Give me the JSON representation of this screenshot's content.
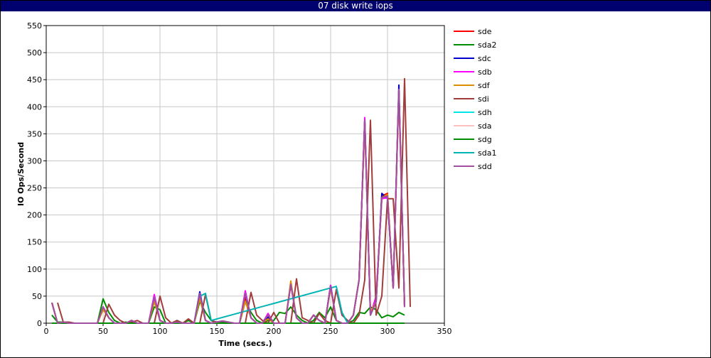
{
  "chart_data": {
    "type": "line",
    "title": "07 disk write iops",
    "xlabel": "Time (secs.)",
    "ylabel": "IO Ops/Second",
    "xlim": [
      0,
      350
    ],
    "ylim": [
      0,
      550
    ],
    "xticks": [
      0,
      50,
      100,
      150,
      200,
      250,
      300,
      350
    ],
    "yticks": [
      0,
      50,
      100,
      150,
      200,
      250,
      300,
      350,
      400,
      450,
      500,
      550
    ],
    "grid": true,
    "legend_position": "right",
    "series": [
      {
        "name": "sde",
        "color": "#ff0000",
        "x": [
          5,
          10,
          15,
          20,
          25,
          30,
          35,
          40,
          45,
          50,
          55,
          60,
          65,
          70,
          75,
          80,
          85,
          90,
          95,
          100,
          105,
          110,
          115,
          120,
          125,
          130,
          135,
          140,
          145,
          150,
          155,
          160,
          165,
          170,
          175,
          180,
          185,
          190,
          195,
          200,
          205,
          210,
          215,
          220,
          225,
          230,
          235,
          240,
          245,
          250,
          255,
          260,
          265,
          270,
          275,
          280,
          285,
          290,
          295,
          300,
          305,
          310,
          315
        ],
        "y": [
          38,
          0,
          2,
          0,
          0,
          0,
          0,
          0,
          0,
          30,
          10,
          0,
          0,
          0,
          5,
          0,
          0,
          0,
          45,
          5,
          0,
          0,
          2,
          0,
          0,
          0,
          50,
          5,
          0,
          2,
          4,
          2,
          0,
          0,
          48,
          10,
          0,
          0,
          10,
          0,
          0,
          0,
          72,
          10,
          0,
          0,
          15,
          5,
          0,
          70,
          5,
          0,
          0,
          15,
          80,
          375,
          20,
          40,
          235,
          240,
          65,
          430,
          30
        ]
      },
      {
        "name": "sda2",
        "color": "#008c00",
        "x": [
          5,
          10,
          15,
          20,
          25,
          30,
          35,
          40,
          45,
          50,
          55,
          60,
          65,
          70,
          75,
          80,
          85,
          90,
          95,
          100,
          105,
          110,
          115,
          120,
          125,
          130,
          135,
          140,
          145,
          150,
          155,
          160,
          165,
          170,
          175,
          180,
          185,
          190,
          195,
          200,
          205,
          210,
          215,
          220,
          225,
          230,
          235,
          240,
          245,
          250,
          255,
          260,
          265,
          270,
          275,
          280,
          285,
          290,
          295,
          300,
          305,
          310,
          315
        ],
        "y": [
          15,
          2,
          2,
          0,
          0,
          0,
          0,
          0,
          0,
          45,
          20,
          5,
          0,
          2,
          0,
          0,
          0,
          0,
          30,
          25,
          0,
          0,
          5,
          0,
          5,
          0,
          40,
          20,
          5,
          0,
          2,
          0,
          0,
          0,
          40,
          20,
          5,
          0,
          5,
          5,
          20,
          18,
          30,
          15,
          5,
          0,
          5,
          20,
          10,
          30,
          5,
          0,
          0,
          5,
          20,
          18,
          30,
          25,
          10,
          15,
          12,
          20,
          15
        ]
      },
      {
        "name": "sdc",
        "color": "#0000c8",
        "x": [
          5,
          10,
          15,
          20,
          25,
          30,
          35,
          40,
          45,
          50,
          55,
          60,
          65,
          70,
          75,
          80,
          85,
          90,
          95,
          100,
          105,
          110,
          115,
          120,
          125,
          130,
          135,
          140,
          145,
          150,
          155,
          160,
          165,
          170,
          175,
          180,
          185,
          190,
          195,
          200,
          205,
          210,
          215,
          220,
          225,
          230,
          235,
          240,
          245,
          250,
          255,
          260,
          265,
          270,
          275,
          280,
          285,
          290,
          295,
          300,
          305,
          310,
          315
        ],
        "y": [
          38,
          0,
          2,
          0,
          0,
          0,
          0,
          0,
          0,
          30,
          10,
          0,
          0,
          0,
          5,
          0,
          0,
          0,
          48,
          5,
          0,
          0,
          2,
          0,
          0,
          0,
          58,
          5,
          0,
          2,
          4,
          2,
          0,
          0,
          55,
          10,
          0,
          0,
          12,
          0,
          0,
          0,
          72,
          10,
          0,
          0,
          15,
          5,
          0,
          70,
          5,
          0,
          0,
          15,
          80,
          375,
          15,
          40,
          240,
          230,
          65,
          440,
          30
        ]
      },
      {
        "name": "sdb",
        "color": "#ff00ff",
        "x": [
          5,
          10,
          15,
          20,
          25,
          30,
          35,
          40,
          45,
          50,
          55,
          60,
          65,
          70,
          75,
          80,
          85,
          90,
          95,
          100,
          105,
          110,
          115,
          120,
          125,
          130,
          135,
          140,
          145,
          150,
          155,
          160,
          165,
          170,
          175,
          180,
          185,
          190,
          195,
          200,
          205,
          210,
          215,
          220,
          225,
          230,
          235,
          240,
          245,
          250,
          255,
          260,
          265,
          270,
          275,
          280,
          285,
          290,
          295,
          300,
          305,
          310,
          315
        ],
        "y": [
          38,
          0,
          2,
          0,
          0,
          0,
          0,
          0,
          0,
          30,
          10,
          0,
          0,
          0,
          5,
          0,
          0,
          0,
          53,
          5,
          0,
          0,
          2,
          0,
          0,
          0,
          52,
          5,
          0,
          2,
          4,
          2,
          0,
          0,
          60,
          10,
          0,
          0,
          18,
          0,
          0,
          0,
          72,
          10,
          0,
          0,
          15,
          5,
          0,
          70,
          5,
          0,
          0,
          15,
          80,
          380,
          15,
          50,
          230,
          232,
          65,
          430,
          30
        ]
      },
      {
        "name": "sdf",
        "color": "#e08c00",
        "x": [
          5,
          10,
          15,
          20,
          25,
          30,
          35,
          40,
          45,
          50,
          55,
          60,
          65,
          70,
          75,
          80,
          85,
          90,
          95,
          100,
          105,
          110,
          115,
          120,
          125,
          130,
          135,
          140,
          145,
          150,
          155,
          160,
          165,
          170,
          175,
          180,
          185,
          190,
          195,
          200,
          205,
          210,
          215,
          220,
          225,
          230,
          235,
          240,
          245,
          250,
          255,
          260,
          265,
          270,
          275,
          280,
          285,
          290,
          295,
          300,
          305,
          310,
          315
        ],
        "y": [
          38,
          0,
          2,
          0,
          0,
          0,
          0,
          0,
          0,
          25,
          10,
          0,
          0,
          0,
          5,
          0,
          0,
          0,
          40,
          5,
          0,
          0,
          2,
          0,
          0,
          0,
          45,
          5,
          0,
          2,
          4,
          2,
          0,
          0,
          40,
          10,
          0,
          0,
          8,
          0,
          0,
          0,
          78,
          10,
          0,
          0,
          15,
          5,
          0,
          65,
          5,
          0,
          0,
          15,
          80,
          370,
          20,
          40,
          232,
          238,
          65,
          430,
          30
        ]
      },
      {
        "name": "sdi",
        "color": "#a03c3c",
        "x": [
          10,
          15,
          20,
          25,
          30,
          35,
          40,
          45,
          50,
          55,
          60,
          65,
          70,
          75,
          80,
          85,
          90,
          95,
          100,
          105,
          110,
          115,
          120,
          125,
          130,
          135,
          140,
          145,
          150,
          155,
          160,
          165,
          170,
          175,
          180,
          185,
          190,
          195,
          200,
          205,
          210,
          215,
          220,
          225,
          230,
          235,
          240,
          245,
          250,
          255,
          260,
          265,
          270,
          275,
          280,
          285,
          290,
          295,
          300,
          305,
          310,
          315,
          320
        ],
        "y": [
          38,
          2,
          2,
          0,
          0,
          0,
          0,
          0,
          0,
          35,
          15,
          5,
          0,
          2,
          5,
          0,
          0,
          0,
          50,
          10,
          0,
          5,
          0,
          8,
          0,
          0,
          53,
          5,
          2,
          4,
          2,
          0,
          0,
          0,
          57,
          15,
          5,
          0,
          20,
          0,
          0,
          0,
          82,
          10,
          5,
          0,
          18,
          5,
          0,
          62,
          15,
          5,
          0,
          15,
          80,
          375,
          15,
          50,
          230,
          230,
          65,
          452,
          30
        ]
      },
      {
        "name": "sdh",
        "color": "#00e6e6",
        "x": [
          5,
          10,
          15,
          20,
          25,
          30,
          35,
          40,
          45,
          50,
          55,
          60,
          65,
          70,
          75,
          80,
          85,
          90,
          95,
          100,
          105,
          110,
          115,
          120,
          125,
          130,
          135,
          140,
          145,
          150,
          155,
          160,
          165,
          170,
          175,
          180,
          185,
          190,
          195,
          200,
          205,
          210,
          215,
          220,
          225,
          230,
          235,
          240,
          245,
          250,
          255,
          260,
          265,
          270,
          275,
          280,
          285,
          290,
          295,
          300,
          305,
          310,
          315
        ],
        "y": [
          0,
          0,
          0,
          0,
          0,
          0,
          0,
          0,
          0,
          0,
          0,
          0,
          0,
          0,
          0,
          0,
          0,
          0,
          0,
          0,
          0,
          0,
          0,
          0,
          0,
          0,
          0,
          0,
          0,
          0,
          0,
          0,
          0,
          0,
          0,
          0,
          0,
          0,
          0,
          0,
          0,
          0,
          0,
          0,
          0,
          0,
          0,
          0,
          0,
          0,
          0,
          0,
          0,
          0,
          0,
          0,
          0,
          0,
          0,
          0,
          0,
          0,
          0
        ]
      },
      {
        "name": "sda",
        "color": "#ffc0c0",
        "x": [
          5,
          10,
          15,
          20,
          25,
          30,
          35,
          40,
          45,
          50,
          55,
          60,
          65,
          70,
          75,
          80,
          85,
          90,
          95,
          100,
          105,
          110,
          115,
          120,
          125,
          130,
          135,
          140,
          145,
          150,
          155,
          160,
          165,
          170,
          175,
          180,
          185,
          190,
          195,
          200,
          205,
          210,
          215,
          220,
          225,
          230,
          235,
          240,
          245,
          250,
          255,
          260,
          265,
          270,
          275,
          280,
          285,
          290,
          295,
          300,
          305,
          310,
          315
        ],
        "y": [
          0,
          0,
          0,
          0,
          0,
          0,
          0,
          0,
          0,
          0,
          0,
          0,
          0,
          0,
          0,
          0,
          0,
          0,
          0,
          0,
          0,
          0,
          0,
          0,
          0,
          0,
          0,
          0,
          0,
          0,
          0,
          0,
          0,
          0,
          0,
          0,
          0,
          0,
          0,
          0,
          0,
          0,
          0,
          0,
          0,
          0,
          0,
          0,
          0,
          0,
          0,
          0,
          0,
          0,
          0,
          0,
          0,
          0,
          0,
          0,
          0,
          0,
          0
        ]
      },
      {
        "name": "sdg",
        "color": "#008c00",
        "x": [
          5,
          10,
          15,
          20,
          25,
          30,
          35,
          40,
          45,
          50,
          55,
          60,
          65,
          70,
          75,
          80,
          85,
          90,
          95,
          100,
          105,
          110,
          115,
          120,
          125,
          130,
          135,
          140,
          145,
          150,
          155,
          160,
          165,
          170,
          175,
          180,
          185,
          190,
          195,
          200,
          205,
          210,
          215,
          220,
          225,
          230,
          235,
          240,
          245,
          250,
          255,
          260,
          265,
          270,
          275,
          280,
          285,
          290,
          295,
          300,
          305,
          310,
          315
        ],
        "y": [
          0,
          0,
          0,
          0,
          0,
          0,
          0,
          0,
          0,
          0,
          0,
          0,
          0,
          0,
          0,
          0,
          0,
          0,
          0,
          0,
          0,
          0,
          0,
          0,
          0,
          0,
          0,
          0,
          0,
          0,
          0,
          0,
          0,
          0,
          0,
          0,
          0,
          0,
          0,
          0,
          0,
          0,
          0,
          0,
          0,
          0,
          0,
          0,
          0,
          0,
          0,
          0,
          0,
          0,
          0,
          0,
          0,
          0,
          0,
          0,
          0,
          0,
          0
        ]
      },
      {
        "name": "sda1",
        "color": "#00b4b4",
        "x": [
          135,
          140,
          145,
          255,
          260,
          265
        ],
        "y": [
          50,
          55,
          5,
          68,
          20,
          0
        ]
      },
      {
        "name": "sdd",
        "color": "#a050a0",
        "x": [
          5,
          10,
          15,
          20,
          25,
          30,
          35,
          40,
          45,
          50,
          55,
          60,
          65,
          70,
          75,
          80,
          85,
          90,
          95,
          100,
          105,
          110,
          115,
          120,
          125,
          130,
          135,
          140,
          145,
          150,
          155,
          160,
          165,
          170,
          175,
          180,
          185,
          190,
          195,
          200,
          205,
          210,
          215,
          220,
          225,
          230,
          235,
          240,
          245,
          250,
          255,
          260,
          265,
          270,
          275,
          280,
          285,
          290,
          295,
          300,
          305,
          310,
          315
        ],
        "y": [
          38,
          0,
          2,
          0,
          0,
          0,
          0,
          0,
          0,
          30,
          10,
          0,
          0,
          0,
          5,
          0,
          0,
          0,
          48,
          5,
          0,
          0,
          2,
          0,
          0,
          0,
          55,
          5,
          0,
          2,
          4,
          2,
          0,
          0,
          55,
          10,
          0,
          0,
          15,
          0,
          0,
          0,
          72,
          10,
          0,
          0,
          15,
          5,
          0,
          68,
          5,
          0,
          0,
          15,
          80,
          375,
          15,
          40,
          232,
          235,
          65,
          432,
          30
        ]
      }
    ]
  }
}
